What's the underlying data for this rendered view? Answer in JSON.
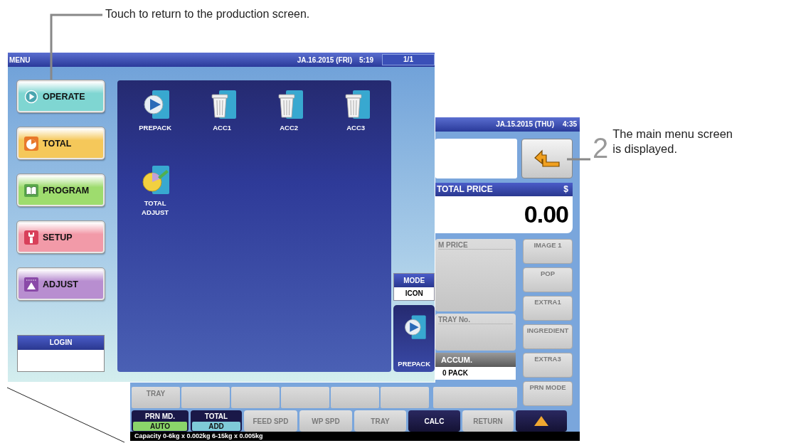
{
  "callouts": [
    {
      "text": "Touch to return to the production screen."
    },
    {
      "number": "2",
      "text": "The main menu screen is displayed."
    }
  ],
  "menu_screen": {
    "title": "MENU",
    "date": "JA.16.2015 (FRI)",
    "time": "5:19",
    "page": "1/1",
    "menu_buttons": [
      {
        "label": "OPERATE",
        "color": "#7fd6d2"
      },
      {
        "label": "TOTAL",
        "color": "#f5c85a"
      },
      {
        "label": "PROGRAM",
        "color": "#9edc6e"
      },
      {
        "label": "SETUP",
        "color": "#f29aa8"
      },
      {
        "label": "ADJUST",
        "color": "#b88ed0"
      }
    ],
    "login": {
      "label": "LOGIN"
    },
    "apps": [
      {
        "label": "PREPACK"
      },
      {
        "label": "ACC1"
      },
      {
        "label": "ACC2"
      },
      {
        "label": "ACC3"
      },
      {
        "label": "TOTAL ADJUST"
      }
    ],
    "mode": {
      "label": "MODE",
      "value": "ICON"
    },
    "current_app": {
      "label": "PREPACK"
    }
  },
  "production_screen": {
    "date": "JA.15.2015 (THU)",
    "time": "4:35",
    "total_price": {
      "label": "TOTAL PRICE",
      "currency": "$",
      "value": "0.00"
    },
    "fields": [
      {
        "label": "M PRICE"
      },
      {
        "label": "TRAY No."
      }
    ],
    "accum": {
      "label": "ACCUM.",
      "value": "0 PACK"
    },
    "side_buttons": [
      {
        "label": "IMAGE 1"
      },
      {
        "label": "POP"
      },
      {
        "label": "EXTRA1"
      },
      {
        "label": "INGREDIENT"
      },
      {
        "label": "EXTRA3"
      },
      {
        "label": "PRN MODE"
      }
    ],
    "tray_row": {
      "label": "TRAY"
    },
    "bottom_buttons": [
      {
        "kind": "pair",
        "label": "PRN MD.",
        "value": "AUTO",
        "color": "#8ad46a"
      },
      {
        "kind": "pair",
        "label": "TOTAL",
        "value": "ADD",
        "color": "#7fcbd8"
      },
      {
        "kind": "plain",
        "label": "FEED SPD",
        "disabled": true
      },
      {
        "kind": "plain",
        "label": "WP SPD",
        "disabled": true
      },
      {
        "kind": "plain",
        "label": "TRAY",
        "disabled": true
      },
      {
        "kind": "plain",
        "label": "CALC",
        "disabled": false
      },
      {
        "kind": "plain",
        "label": "RETURN",
        "disabled": true
      },
      {
        "kind": "arrow",
        "disabled": false
      }
    ],
    "status": "Capacity 0-6kg x 0.002kg  6-15kg x 0.005kg"
  }
}
